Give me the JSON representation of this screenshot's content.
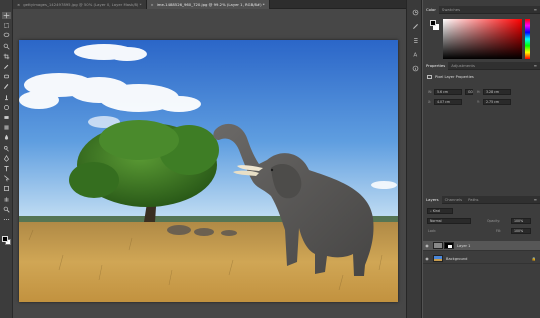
{
  "tabs": [
    {
      "label": "gettyimages_142497895.jpg @ 50% (Layer 0, Layer Mask/8) *",
      "active": false
    },
    {
      "label": "ime-1488526_960_720.jpg @ 99.2% (Layer 1, RGB/8#) *",
      "active": true
    }
  ],
  "tools": [
    "move-icon",
    "marquee-icon",
    "lasso-icon",
    "quick-select-icon",
    "crop-icon",
    "eyedropper-icon",
    "healing-icon",
    "brush-icon",
    "stamp-icon",
    "history-brush-icon",
    "eraser-icon",
    "gradient-icon",
    "blur-icon",
    "dodge-icon",
    "pen-icon",
    "type-icon",
    "path-select-icon",
    "shape-icon",
    "hand-icon",
    "zoom-icon",
    "more-icon"
  ],
  "color_panel": {
    "tabs": [
      "Color",
      "Swatches"
    ],
    "fg": "#000000",
    "bg": "#ffffff"
  },
  "properties": {
    "tabs": [
      "Properties",
      "Adjustments"
    ],
    "subtitle": "Pixel Layer Properties",
    "W": "5.6 cm",
    "H": "3.28 cm",
    "link": "GO",
    "X": "4.07 cm",
    "Y": "2.75 cm"
  },
  "layers": {
    "tabs": [
      "Layers",
      "Channels",
      "Paths"
    ],
    "filter": "Kind",
    "blend_mode": "Normal",
    "opacity_label": "Opacity:",
    "opacity": "100%",
    "lock_label": "Lock:",
    "fill_label": "Fill:",
    "fill": "100%",
    "items": [
      {
        "name": "Layer 1",
        "selected": true,
        "locked": false
      },
      {
        "name": "Background",
        "selected": false,
        "locked": true
      }
    ]
  },
  "colors": {
    "sky_top": "#2e6fd0",
    "sky_bottom": "#bcd9f2",
    "grass": "#c79c4e",
    "tree": "#3d7a22",
    "elephant": "#565554",
    "ui_dark": "#3d3d3d"
  }
}
